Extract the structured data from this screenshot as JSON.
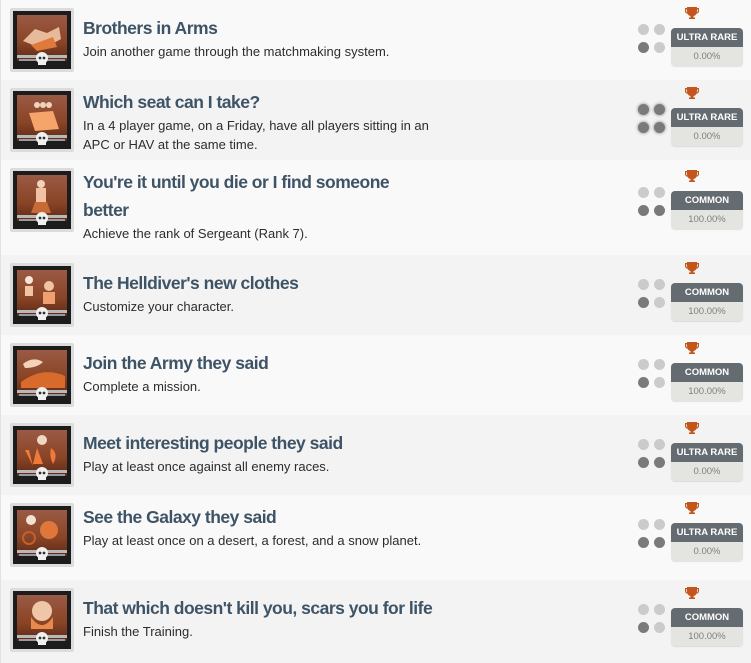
{
  "achievements": [
    {
      "title": "Brothers in Arms",
      "description": "Join another game through the matchmaking system.",
      "rarity": "ULTRA RARE",
      "percent": "0.00%",
      "dots": [
        false,
        false,
        true,
        false
      ],
      "icon": "handshake-icon"
    },
    {
      "title": "Which seat can I take?",
      "description": "In a 4 player game, on a Friday, have all players sitting in an APC or HAV at the same time.",
      "rarity": "ULTRA RARE",
      "percent": "0.00%",
      "dots": [
        true,
        true,
        true,
        true
      ],
      "icon": "vehicle-seat-icon"
    },
    {
      "title": "You're it until you die or I find someone better",
      "description": "Achieve the rank of Sergeant (Rank 7).",
      "rarity": "COMMON",
      "percent": "100.00%",
      "dots": [
        false,
        false,
        true,
        true
      ],
      "icon": "soldier-rank-icon"
    },
    {
      "title": "The Helldiver's new clothes",
      "description": "Customize your character.",
      "rarity": "COMMON",
      "percent": "100.00%",
      "dots": [
        false,
        false,
        true,
        false
      ],
      "icon": "customize-clothes-icon"
    },
    {
      "title": "Join the Army they said",
      "description": "Complete a mission.",
      "rarity": "COMMON",
      "percent": "100.00%",
      "dots": [
        false,
        false,
        true,
        false
      ],
      "icon": "dropship-icon"
    },
    {
      "title": "Meet interesting people they said",
      "description": "Play at least once against all enemy races.",
      "rarity": "ULTRA RARE",
      "percent": "0.00%",
      "dots": [
        false,
        false,
        true,
        true
      ],
      "icon": "enemy-races-icon"
    },
    {
      "title": "See the Galaxy they said",
      "description": "Play at least once on a desert, a forest, and a snow planet.",
      "rarity": "ULTRA RARE",
      "percent": "0.00%",
      "dots": [
        false,
        false,
        true,
        true
      ],
      "icon": "planets-icon"
    },
    {
      "title": "That which doesn't kill you, scars you for life",
      "description": "Finish the Training.",
      "rarity": "COMMON",
      "percent": "100.00%",
      "dots": [
        false,
        false,
        true,
        false
      ],
      "icon": "scarred-face-icon"
    }
  ],
  "colors": {
    "title": "#3e5466",
    "trophy": "#c4551c",
    "badge": "#656c71",
    "dot_on": "#7a7a7a",
    "dot_off": "#cbcbcb"
  }
}
